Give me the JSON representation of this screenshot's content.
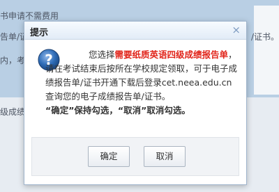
{
  "background": {
    "line1": "书申请不需费用",
    "line2_left": "告单/证",
    "line2_right": "/证书。",
    "line3": "内，考",
    "line4": "级成绩"
  },
  "dialog": {
    "title": "提示",
    "close_icon": "×",
    "message": {
      "part1": "您选择",
      "highlight": "需要纸质英语四级成绩报告单",
      "part2": "，请在考试结束后按所在学校规定领取，可于电子成绩报告单/证书开通下载后登录cet.neea.edu.cn查询您的电子成绩报告单/证书。",
      "note": "“确定”保持勾选，“取消”取消勾选。"
    },
    "buttons": {
      "ok": "确定",
      "cancel": "取消"
    }
  }
}
